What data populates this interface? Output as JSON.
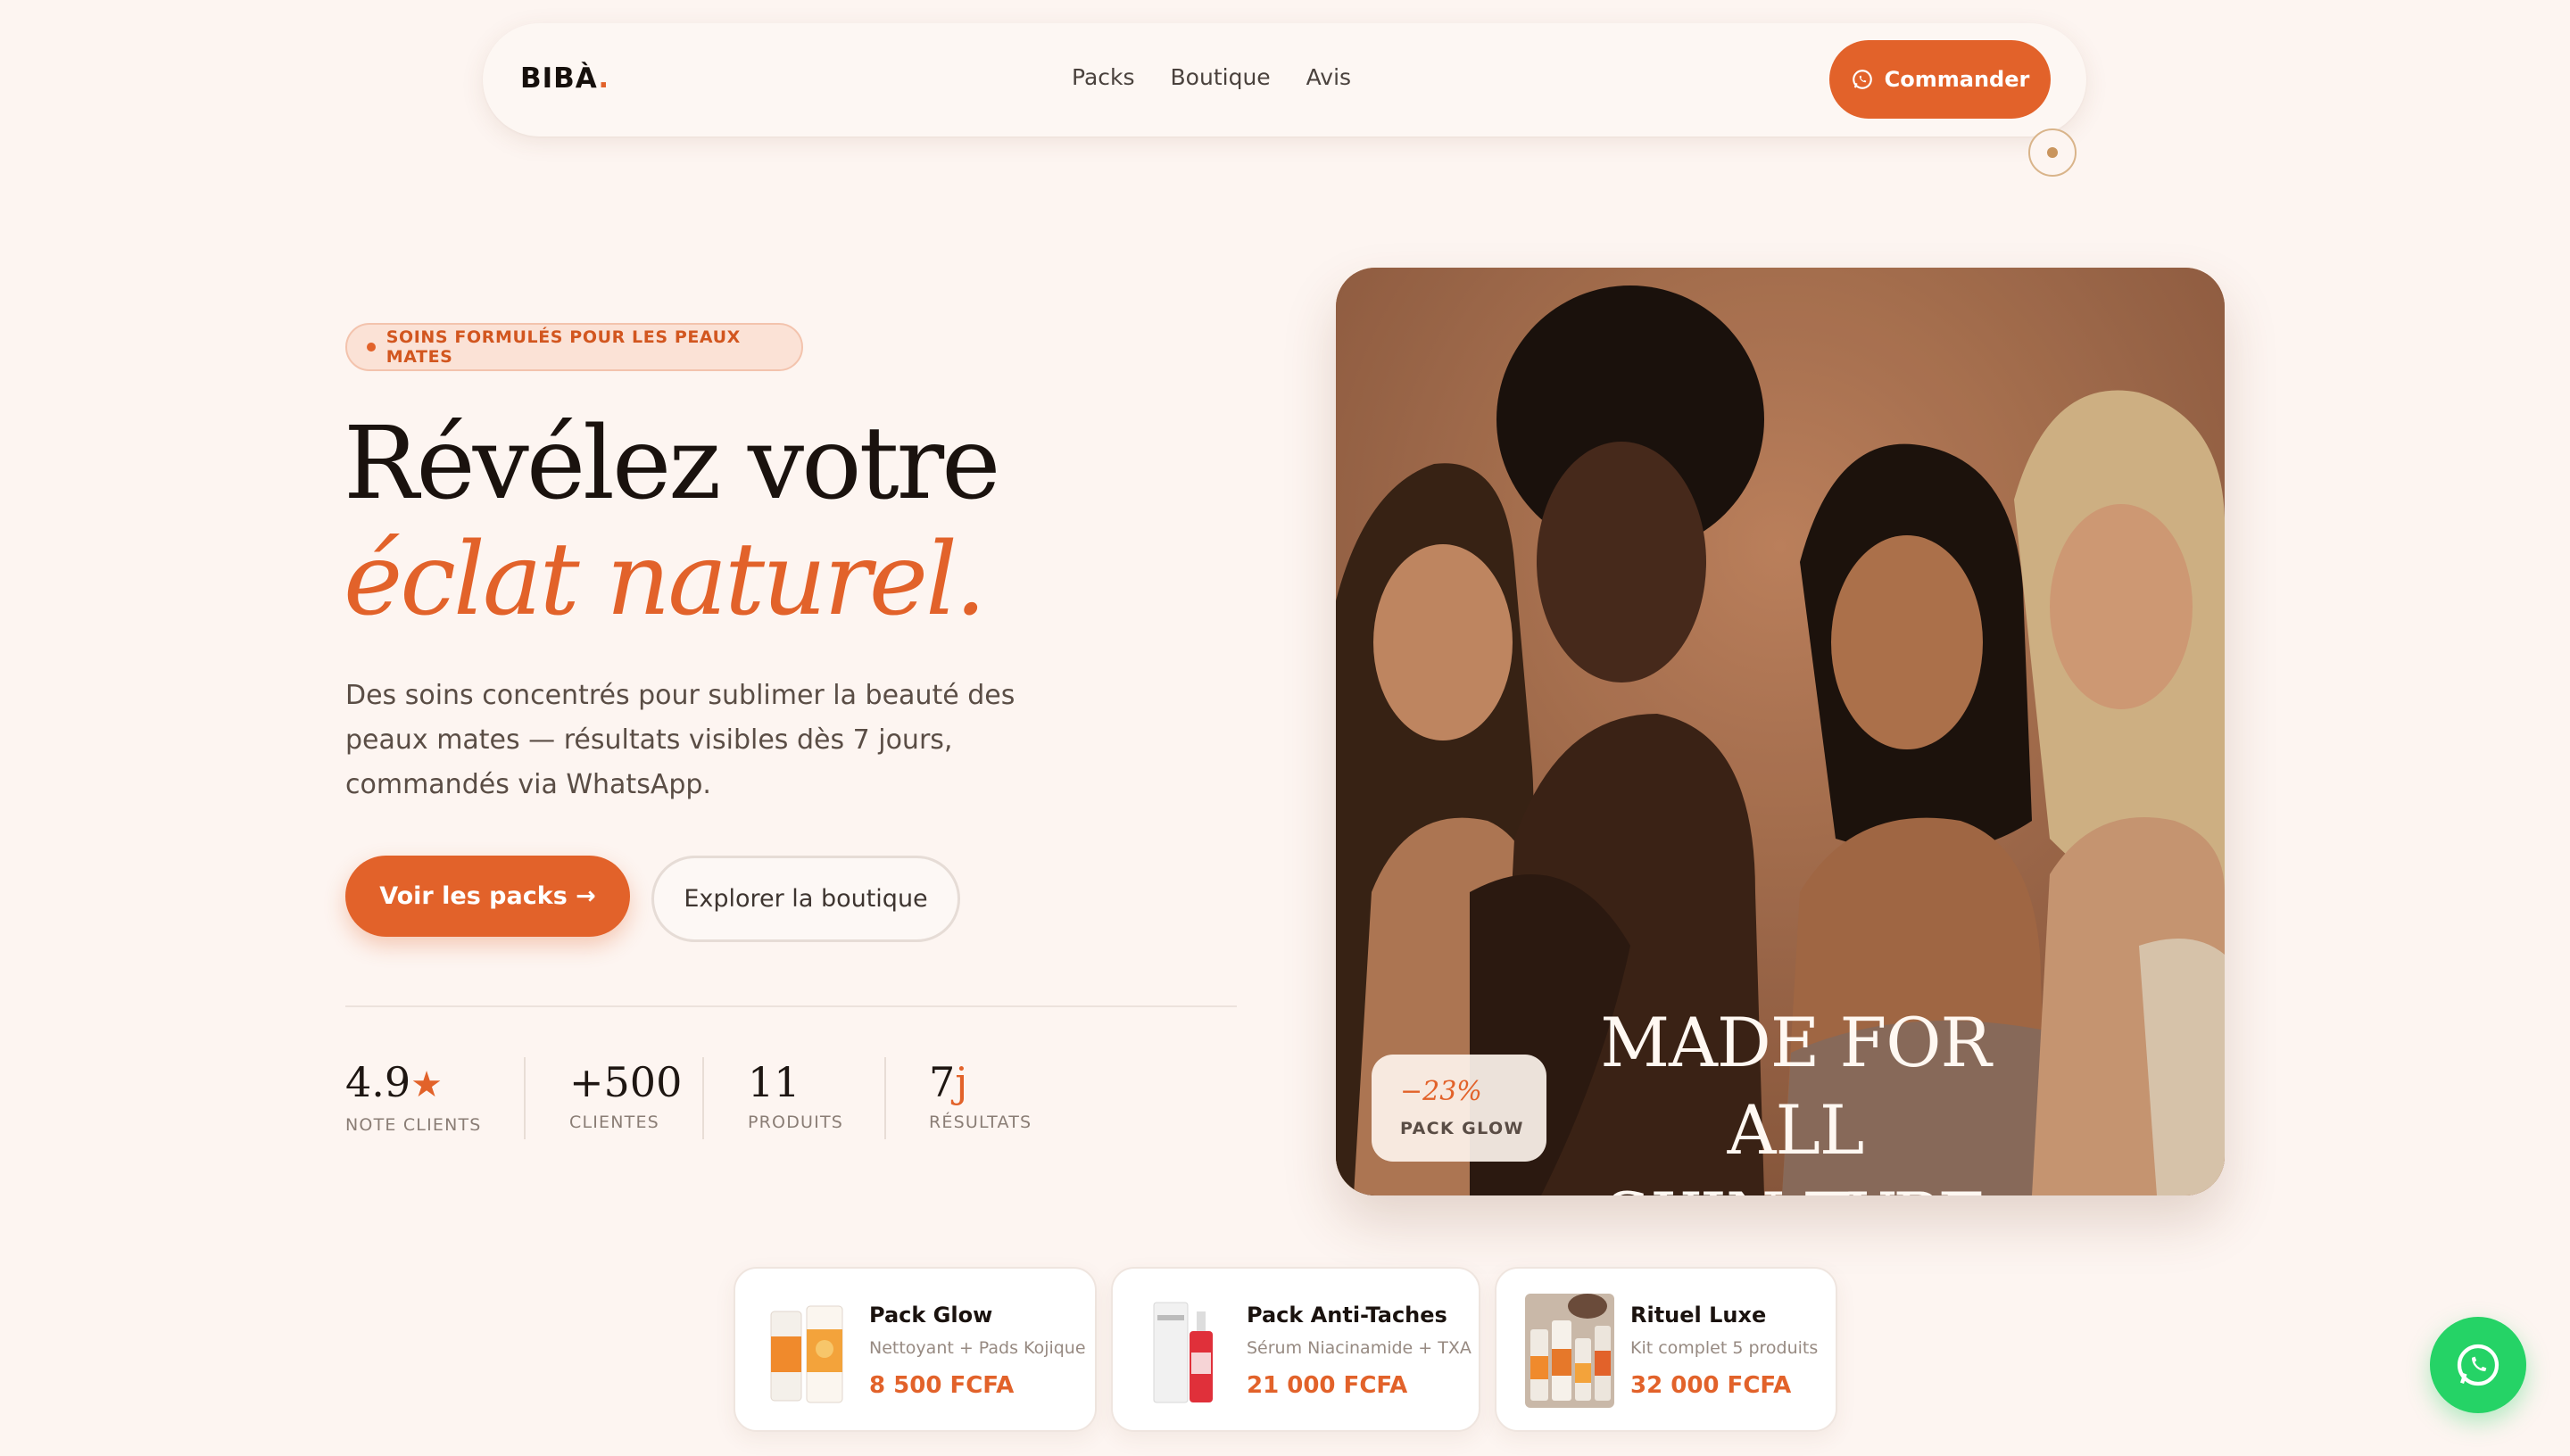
{
  "nav": {
    "logo": "BIBÀ",
    "logo_dot": ".",
    "links": [
      "Packs",
      "Boutique",
      "Avis"
    ],
    "cta_label": "Commander",
    "cta_icon": "whatsapp-icon"
  },
  "hero": {
    "badge": "SOINS FORMULÉS POUR LES PEAUX MATES",
    "title_line1": "Révélez votre",
    "title_line2": "éclat naturel.",
    "description": "Des soins concentrés pour sublimer la beauté des peaux mates — résultats visibles dès 7 jours, commandés via WhatsApp.",
    "primary_button": "Voir les packs →",
    "secondary_button": "Explorer la boutique"
  },
  "stats": [
    {
      "value": "4.9",
      "suffix": "★",
      "label": "NOTE CLIENTS"
    },
    {
      "value": "+500",
      "suffix": "",
      "label": "CLIENTES"
    },
    {
      "value": "11",
      "suffix": "",
      "label": "PRODUITS"
    },
    {
      "value": "7",
      "suffix": "j",
      "label": "RÉSULTATS"
    }
  ],
  "image": {
    "overlay_line1": "MADE FOR ALL",
    "overlay_line2": "SKIN TYPE",
    "discount_value": "−23%",
    "discount_label": "PACK GLOW"
  },
  "products": [
    {
      "name": "Pack Glow",
      "subtitle": "Nettoyant + Pads Kojique",
      "price": "8 500 FCFA"
    },
    {
      "name": "Pack Anti-Taches",
      "subtitle": "Sérum Niacinamide + TXA",
      "price": "21 000 FCFA"
    },
    {
      "name": "Rituel Luxe",
      "subtitle": "Kit complet 5 produits",
      "price": "32 000 FCFA"
    }
  ],
  "fab_icon": "whatsapp-icon",
  "colors": {
    "accent": "#e2622a",
    "background": "#fdf5f1",
    "whatsapp": "#25d366"
  }
}
